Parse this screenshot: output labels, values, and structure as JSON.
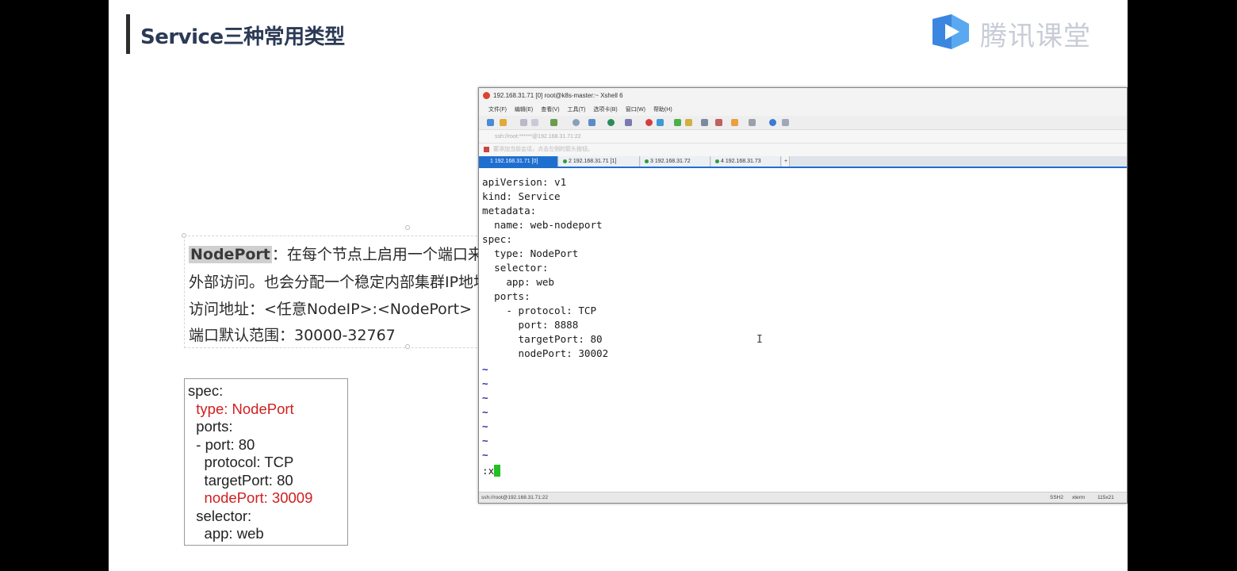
{
  "slide": {
    "title": "Service三种常用类型",
    "logo_text": "腾讯课堂",
    "logo_icon": "tencent-classroom-play-icon"
  },
  "description": {
    "highlight": "NodePort",
    "line1_rest": "：在每个节点上启用一个端口来暴",
    "line2": "外部访问。也会分配一个稳定内部集群IP地址",
    "line3": "访问地址：<任意NodeIP>:<NodePort>",
    "line4": "端口默认范围：30000-32767"
  },
  "yaml_box": {
    "lines": [
      "spec:",
      "  type: NodePort",
      "  ports:",
      "  - port: 80",
      "    protocol: TCP",
      "    targetPort: 80",
      "    nodePort: 30009",
      "  selector:",
      "    app: web"
    ],
    "red_lines": [
      1,
      6
    ]
  },
  "terminal": {
    "title": "192.168.31.71 [0]   root@k8s-master:~   Xshell 6",
    "menu": [
      "文件(F)",
      "编辑(E)",
      "查看(V)",
      "工具(T)",
      "选项卡(B)",
      "窗口(W)",
      "帮助(H)"
    ],
    "address": "ssh://root:******@192.168.31.71:22",
    "address2": "要添加当前会话，点击左侧的箭头按钮。",
    "tabs": [
      {
        "label": "1 192.168.31.71 [0]",
        "active": true
      },
      {
        "label": "2 192.168.31.71 [1]",
        "active": false
      },
      {
        "label": "3 192.168.31.72",
        "active": false
      },
      {
        "label": "4 192.168.31.73",
        "active": false
      },
      {
        "label": "+",
        "active": false
      }
    ],
    "screen_lines": [
      "apiVersion: v1",
      "kind: Service",
      "metadata:",
      "  name: web-nodeport",
      "spec:",
      "  type: NodePort",
      "  selector:",
      "    app: web",
      "  ports:",
      "    - protocol: TCP",
      "      port: 8888",
      "      targetPort: 80",
      "      nodePort: 30002",
      "~",
      "~",
      "~",
      "~",
      "~",
      "~",
      "~"
    ],
    "command": ":x",
    "status_left": "ssh://root@192.168.31.71:22",
    "status_proto": "SSH2",
    "status_term": "xterm",
    "status_size": "115x21"
  },
  "colors": {
    "accent_red": "#d02020",
    "tab_blue": "#1f6fd0",
    "cursor_green": "#22c022"
  }
}
